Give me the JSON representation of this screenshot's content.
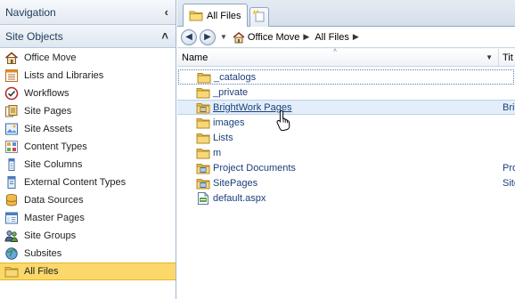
{
  "nav": {
    "title": "Navigation",
    "collapse_glyph": "‹",
    "section": {
      "title": "Site Objects",
      "collapse_glyph": "˄",
      "items": [
        {
          "label": "Office Move",
          "icon": "site-home-icon"
        },
        {
          "label": "Lists and Libraries",
          "icon": "list-icon"
        },
        {
          "label": "Workflows",
          "icon": "workflow-icon"
        },
        {
          "label": "Site Pages",
          "icon": "site-pages-icon"
        },
        {
          "label": "Site Assets",
          "icon": "site-assets-icon"
        },
        {
          "label": "Content Types",
          "icon": "content-types-icon"
        },
        {
          "label": "Site Columns",
          "icon": "site-columns-icon"
        },
        {
          "label": "External Content Types",
          "icon": "external-content-types-icon"
        },
        {
          "label": "Data Sources",
          "icon": "data-sources-icon"
        },
        {
          "label": "Master Pages",
          "icon": "master-pages-icon"
        },
        {
          "label": "Site Groups",
          "icon": "site-groups-icon"
        },
        {
          "label": "Subsites",
          "icon": "subsites-icon"
        },
        {
          "label": "All Files",
          "icon": "folder-icon",
          "selected": true
        }
      ]
    }
  },
  "tabs": {
    "active_label": "All Files"
  },
  "breadcrumb": {
    "back_glyph": "◀",
    "forward_glyph": "▶",
    "dropdown_glyph": "▼",
    "separator_glyph": "▶",
    "items": [
      "Office Move",
      "All Files"
    ]
  },
  "list": {
    "columns": {
      "name": "Name",
      "title": "Tit"
    },
    "sort_glyph": "˄",
    "filter_glyph": "▼",
    "rows": [
      {
        "name": "_catalogs",
        "title": "",
        "icon": "folder-icon",
        "state": "focused"
      },
      {
        "name": "_private",
        "title": "",
        "icon": "folder-icon",
        "state": ""
      },
      {
        "name": "BrightWork Pages",
        "title": "Brig",
        "icon": "pages-library-icon",
        "state": "hover"
      },
      {
        "name": "images",
        "title": "",
        "icon": "folder-icon",
        "state": ""
      },
      {
        "name": "Lists",
        "title": "",
        "icon": "folder-icon",
        "state": ""
      },
      {
        "name": "m",
        "title": "",
        "icon": "folder-icon",
        "state": ""
      },
      {
        "name": "Project Documents",
        "title": "Pro",
        "icon": "document-library-icon",
        "state": ""
      },
      {
        "name": "SitePages",
        "title": "Site",
        "icon": "document-library-icon",
        "state": ""
      },
      {
        "name": "default.aspx",
        "title": "",
        "icon": "aspx-file-icon",
        "state": ""
      }
    ]
  },
  "colors": {
    "selection": "#fcd86b",
    "link": "#1a3f7a",
    "pane_border": "#9eb6ce"
  }
}
